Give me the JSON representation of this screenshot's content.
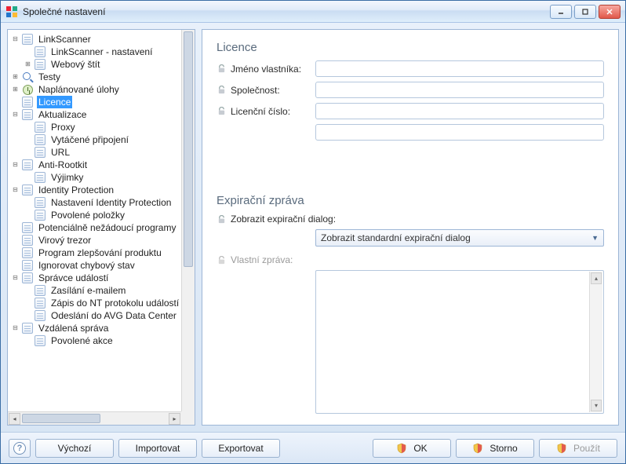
{
  "window": {
    "title": "Společné nastavení"
  },
  "tree": {
    "linkscanner": "LinkScanner",
    "linkscanner_settings": "LinkScanner - nastavení",
    "webshield": "Webový štít",
    "tests": "Testy",
    "scheduled": "Naplánované úlohy",
    "licence": "Licence",
    "update": "Aktualizace",
    "proxy": "Proxy",
    "dialup": "Vytáčené připojení",
    "url": "URL",
    "antirootkit": "Anti-Rootkit",
    "exceptions": "Výjimky",
    "idp": "Identity Protection",
    "idp_settings": "Nastavení Identity Protection",
    "idp_allowed": "Povolené položky",
    "pup": "Potenciálně nežádoucí programy",
    "vault": "Virový trezor",
    "pip": "Program zlepšování produktu",
    "ignore_err": "Ignorovat chybový stav",
    "event_mgr": "Správce událostí",
    "email_send": "Zasílání e-mailem",
    "nt_log": "Zápis do NT protokolu událostí",
    "avg_dc": "Odeslání do AVG Data Center",
    "remote": "Vzdálená správa",
    "allowed_actions": "Povolené akce"
  },
  "content": {
    "licence_title": "Licence",
    "owner_label": "Jméno vlastníka:",
    "company_label": "Společnost:",
    "licno_label": "Licenční číslo:",
    "owner_value": "",
    "company_value": "",
    "licno_value": "",
    "extra_value": "",
    "exp_title": "Expirační zpráva",
    "exp_show_label": "Zobrazit expirační dialog:",
    "exp_select_value": "Zobrazit standardní expirační dialog",
    "custom_msg_label": "Vlastní zpráva:",
    "custom_msg_value": ""
  },
  "buttons": {
    "default": "Výchozí",
    "import": "Importovat",
    "export": "Exportovat",
    "ok": "OK",
    "cancel": "Storno",
    "apply": "Použít"
  }
}
